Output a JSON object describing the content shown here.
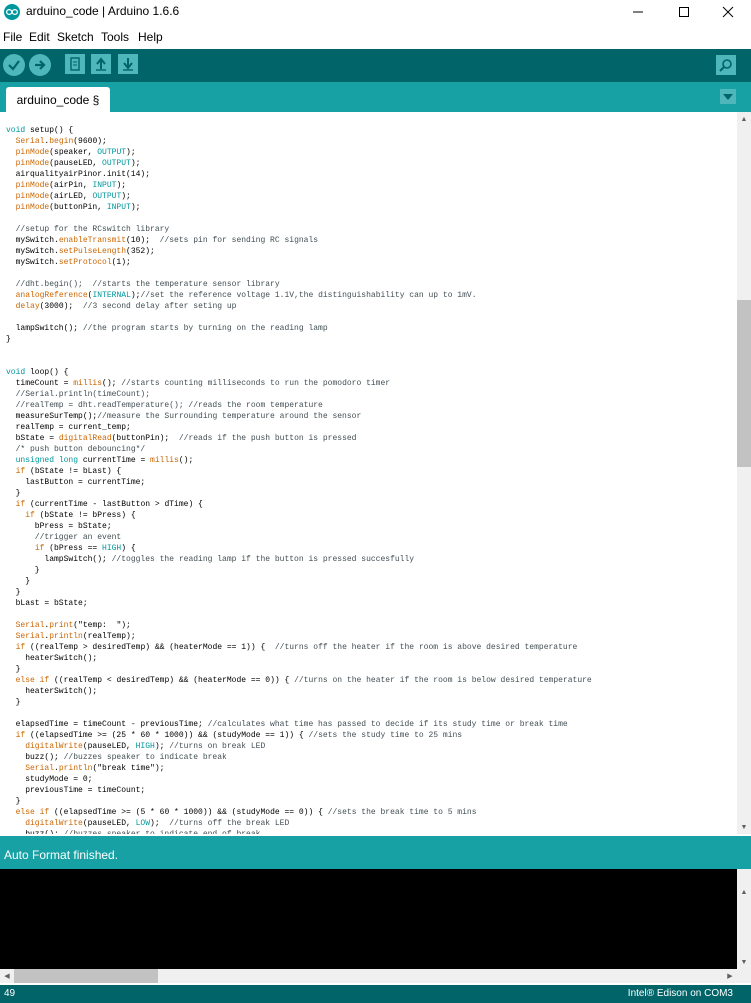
{
  "window": {
    "title": "arduino_code | Arduino 1.6.6"
  },
  "menu": [
    "File",
    "Edit",
    "Sketch",
    "Tools",
    "Help"
  ],
  "tab": {
    "label": "arduino_code §"
  },
  "status": {
    "message": "Auto Format finished."
  },
  "footer": {
    "line_number": "49",
    "board": "Intel® Edison on COM3"
  },
  "colors": {
    "toolbar": "#006468",
    "tabbar": "#17a1a5",
    "button": "#4db7bb",
    "keyword": "#cc6600",
    "type": "#00979c",
    "comment": "#434f54"
  },
  "code": [
    [
      [
        "kt",
        "void"
      ],
      [
        "p",
        " setup() {"
      ]
    ],
    [
      [
        "p",
        "  "
      ],
      [
        "kw",
        "Serial"
      ],
      [
        "p",
        "."
      ],
      [
        "kw",
        "begin"
      ],
      [
        "p",
        "(9600);"
      ]
    ],
    [
      [
        "p",
        "  "
      ],
      [
        "kw",
        "pinMode"
      ],
      [
        "p",
        "(speaker, "
      ],
      [
        "kt",
        "OUTPUT"
      ],
      [
        "p",
        ");"
      ]
    ],
    [
      [
        "p",
        "  "
      ],
      [
        "kw",
        "pinMode"
      ],
      [
        "p",
        "(pauseLED, "
      ],
      [
        "kt",
        "OUTPUT"
      ],
      [
        "p",
        ");"
      ]
    ],
    [
      [
        "p",
        "  airqualityairPinor.init(14);"
      ]
    ],
    [
      [
        "p",
        "  "
      ],
      [
        "kw",
        "pinMode"
      ],
      [
        "p",
        "(airPin, "
      ],
      [
        "kt",
        "INPUT"
      ],
      [
        "p",
        ");"
      ]
    ],
    [
      [
        "p",
        "  "
      ],
      [
        "kw",
        "pinMode"
      ],
      [
        "p",
        "(airLED, "
      ],
      [
        "kt",
        "OUTPUT"
      ],
      [
        "p",
        ");"
      ]
    ],
    [
      [
        "p",
        "  "
      ],
      [
        "kw",
        "pinMode"
      ],
      [
        "p",
        "(buttonPin, "
      ],
      [
        "kt",
        "INPUT"
      ],
      [
        "p",
        ");"
      ]
    ],
    [
      [
        "p",
        ""
      ]
    ],
    [
      [
        "c",
        "  //setup for the RCswitch library"
      ]
    ],
    [
      [
        "p",
        "  mySwitch."
      ],
      [
        "kw",
        "enableTransmit"
      ],
      [
        "p",
        "(10);  "
      ],
      [
        "c",
        "//sets pin for sending RC signals"
      ]
    ],
    [
      [
        "p",
        "  mySwitch."
      ],
      [
        "kw",
        "setPulseLength"
      ],
      [
        "p",
        "(352);"
      ]
    ],
    [
      [
        "p",
        "  mySwitch."
      ],
      [
        "kw",
        "setProtocol"
      ],
      [
        "p",
        "(1);"
      ]
    ],
    [
      [
        "p",
        ""
      ]
    ],
    [
      [
        "c",
        "  //dht.begin();  //starts the temperature sensor library"
      ]
    ],
    [
      [
        "p",
        "  "
      ],
      [
        "kw",
        "analogReference"
      ],
      [
        "p",
        "("
      ],
      [
        "kt",
        "INTERNAL"
      ],
      [
        "p",
        ");"
      ],
      [
        "c",
        "//set the reference voltage 1.1V,the distinguishability can up to 1mV."
      ]
    ],
    [
      [
        "p",
        "  "
      ],
      [
        "kw",
        "delay"
      ],
      [
        "p",
        "(3000);  "
      ],
      [
        "c",
        "//3 second delay after seting up"
      ]
    ],
    [
      [
        "p",
        ""
      ]
    ],
    [
      [
        "p",
        "  lampSwitch(); "
      ],
      [
        "c",
        "//the program starts by turning on the reading lamp"
      ]
    ],
    [
      [
        "p",
        "}"
      ]
    ],
    [
      [
        "p",
        ""
      ]
    ],
    [
      [
        "p",
        ""
      ]
    ],
    [
      [
        "kt",
        "void"
      ],
      [
        "p",
        " loop() {"
      ]
    ],
    [
      [
        "p",
        "  timeCount = "
      ],
      [
        "kw",
        "millis"
      ],
      [
        "p",
        "(); "
      ],
      [
        "c",
        "//starts counting milliseconds to run the pomodoro timer"
      ]
    ],
    [
      [
        "c",
        "  //Serial.println(timeCount);"
      ]
    ],
    [
      [
        "c",
        "  //realTemp = dht.readTemperature(); //reads the room temperature"
      ]
    ],
    [
      [
        "p",
        "  measureSurTemp();"
      ],
      [
        "c",
        "//measure the Surrounding temperature around the sensor"
      ]
    ],
    [
      [
        "p",
        "  realTemp = current_temp;"
      ]
    ],
    [
      [
        "p",
        "  bState = "
      ],
      [
        "kw",
        "digitalRead"
      ],
      [
        "p",
        "(buttonPin);  "
      ],
      [
        "c",
        "//reads if the push button is pressed"
      ]
    ],
    [
      [
        "c",
        "  /* push button debouncing*/"
      ]
    ],
    [
      [
        "p",
        "  "
      ],
      [
        "kt",
        "unsigned long"
      ],
      [
        "p",
        " currentTime = "
      ],
      [
        "kw",
        "millis"
      ],
      [
        "p",
        "();"
      ]
    ],
    [
      [
        "p",
        "  "
      ],
      [
        "kw",
        "if"
      ],
      [
        "p",
        " (bState != bLast) {"
      ]
    ],
    [
      [
        "p",
        "    lastButton = currentTime;"
      ]
    ],
    [
      [
        "p",
        "  }"
      ]
    ],
    [
      [
        "p",
        "  "
      ],
      [
        "kw",
        "if"
      ],
      [
        "p",
        " (currentTime - lastButton > dTime) {"
      ]
    ],
    [
      [
        "p",
        "    "
      ],
      [
        "kw",
        "if"
      ],
      [
        "p",
        " (bState != bPress) {"
      ]
    ],
    [
      [
        "p",
        "      bPress = bState;"
      ]
    ],
    [
      [
        "c",
        "      //trigger an event"
      ]
    ],
    [
      [
        "p",
        "      "
      ],
      [
        "kw",
        "if"
      ],
      [
        "p",
        " (bPress == "
      ],
      [
        "kt",
        "HIGH"
      ],
      [
        "p",
        ") {"
      ]
    ],
    [
      [
        "p",
        "        lampSwitch(); "
      ],
      [
        "c",
        "//toggles the reading lamp if the button is pressed succesfully"
      ]
    ],
    [
      [
        "p",
        "      }"
      ]
    ],
    [
      [
        "p",
        "    }"
      ]
    ],
    [
      [
        "p",
        "  }"
      ]
    ],
    [
      [
        "p",
        "  bLast = bState;"
      ]
    ],
    [
      [
        "p",
        ""
      ]
    ],
    [
      [
        "p",
        "  "
      ],
      [
        "kw",
        "Serial"
      ],
      [
        "p",
        "."
      ],
      [
        "kw",
        "print"
      ],
      [
        "p",
        "(\"temp:  \");"
      ]
    ],
    [
      [
        "p",
        "  "
      ],
      [
        "kw",
        "Serial"
      ],
      [
        "p",
        "."
      ],
      [
        "kw",
        "println"
      ],
      [
        "p",
        "(realTemp);"
      ]
    ],
    [
      [
        "p",
        "  "
      ],
      [
        "kw",
        "if"
      ],
      [
        "p",
        " ((realTemp > desiredTemp) && (heaterMode == 1)) {  "
      ],
      [
        "c",
        "//turns off the heater if the room is above desired temperature"
      ]
    ],
    [
      [
        "p",
        "    heaterSwitch();"
      ]
    ],
    [
      [
        "p",
        "  }"
      ]
    ],
    [
      [
        "p",
        "  "
      ],
      [
        "kw",
        "else"
      ],
      [
        "p",
        " "
      ],
      [
        "kw",
        "if"
      ],
      [
        "p",
        " ((realTemp < desiredTemp) && (heaterMode == 0)) { "
      ],
      [
        "c",
        "//turns on the heater if the room is below desired temperature"
      ]
    ],
    [
      [
        "p",
        "    heaterSwitch();"
      ]
    ],
    [
      [
        "p",
        "  }"
      ]
    ],
    [
      [
        "p",
        ""
      ]
    ],
    [
      [
        "p",
        "  elapsedTime = timeCount - previousTime; "
      ],
      [
        "c",
        "//calculates what time has passed to decide if its study time or break time"
      ]
    ],
    [
      [
        "p",
        "  "
      ],
      [
        "kw",
        "if"
      ],
      [
        "p",
        " ((elapsedTime >= (25 * 60 * 1000)) && (studyMode == 1)) { "
      ],
      [
        "c",
        "//sets the study time to 25 mins"
      ]
    ],
    [
      [
        "p",
        "    "
      ],
      [
        "kw",
        "digitalWrite"
      ],
      [
        "p",
        "(pauseLED, "
      ],
      [
        "kt",
        "HIGH"
      ],
      [
        "p",
        "); "
      ],
      [
        "c",
        "//turns on break LED"
      ]
    ],
    [
      [
        "p",
        "    buzz(); "
      ],
      [
        "c",
        "//buzzes speaker to indicate break"
      ]
    ],
    [
      [
        "p",
        "    "
      ],
      [
        "kw",
        "Serial"
      ],
      [
        "p",
        "."
      ],
      [
        "kw",
        "println"
      ],
      [
        "p",
        "(\"break time\");"
      ]
    ],
    [
      [
        "p",
        "    studyMode = 0;"
      ]
    ],
    [
      [
        "p",
        "    previousTime = timeCount;"
      ]
    ],
    [
      [
        "p",
        "  }"
      ]
    ],
    [
      [
        "p",
        "  "
      ],
      [
        "kw",
        "else"
      ],
      [
        "p",
        " "
      ],
      [
        "kw",
        "if"
      ],
      [
        "p",
        " ((elapsedTime >= (5 * 60 * 1000)) && (studyMode == 0)) { "
      ],
      [
        "c",
        "//sets the break time to 5 mins"
      ]
    ],
    [
      [
        "p",
        "    "
      ],
      [
        "kw",
        "digitalWrite"
      ],
      [
        "p",
        "(pauseLED, "
      ],
      [
        "kt",
        "LOW"
      ],
      [
        "p",
        ");  "
      ],
      [
        "c",
        "//turns off the break LED"
      ]
    ],
    [
      [
        "p",
        "    buzz(); "
      ],
      [
        "c",
        "//buzzes speaker to indicate end of break"
      ]
    ]
  ]
}
